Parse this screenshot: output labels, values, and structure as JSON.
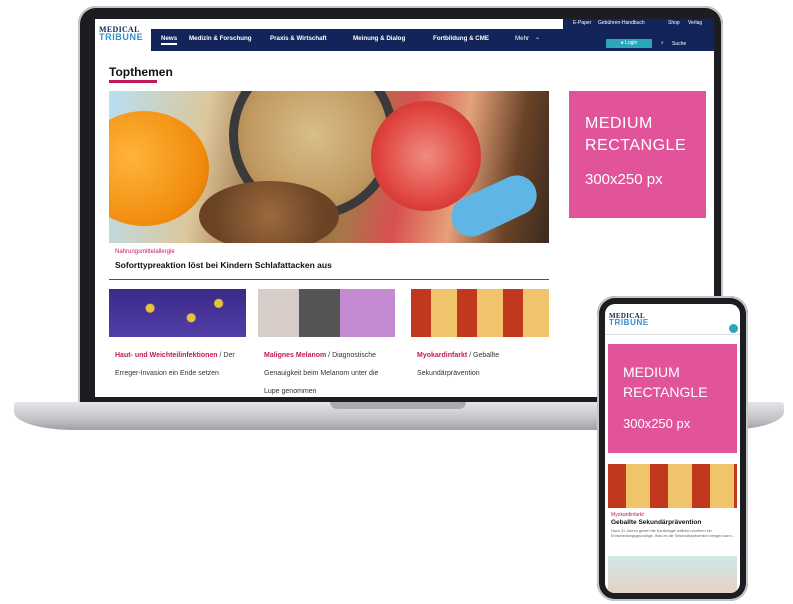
{
  "site": {
    "logo_top": "MEDICAL",
    "logo_bottom": "TRIBUNE",
    "top_links": [
      "E-Paper",
      "Gebühren-Handbuch",
      "Shop",
      "Verlag"
    ],
    "nav": [
      "News",
      "Medizin & Forschung",
      "Praxis & Wirtschaft",
      "Meinung & Dialog",
      "Fortbildung & CME",
      "Mehr"
    ],
    "login": "Login",
    "search": "Suche"
  },
  "main": {
    "section_title": "Topthemen",
    "hero": {
      "kicker": "Nahrungsmittelallergie",
      "headline": "Soforttypreaktion löst bei Kindern Schlafattacken aus"
    },
    "cards": [
      {
        "title": "Haut- und Weichteilinfektionen",
        "sep": " / ",
        "text": "Der Erreger-Invasion ein Ende setzen"
      },
      {
        "title": "Malignes Melanom",
        "sep": " / ",
        "text": "Diagnostische Genauigkeit beim Melanom unter die Lupe genommen"
      },
      {
        "title": "Myokardinfarkt",
        "sep": " / ",
        "text": "Geballte Sekundärprävention"
      }
    ]
  },
  "ad": {
    "line1": "MEDIUM",
    "line2": "RECTANGLE",
    "size": "300x250 px"
  },
  "mobile": {
    "ad_line1": "MEDIUM",
    "ad_line2": "RECTANGLE",
    "ad_size": "300x250 px",
    "kicker": "Myokardinfarkt",
    "headline": "Geballte Sekundärprävention",
    "teaser": "Nach 31 Jahren geriert die Kardiologie leitlinien-konform ein Entscheidungsgrundlage. Was es die Sekundärprävention bringen kann..."
  },
  "colors": {
    "navy": "#12245a",
    "accent": "#c2185b",
    "ad_pink": "#e2549a",
    "teal": "#2ca6b9"
  }
}
